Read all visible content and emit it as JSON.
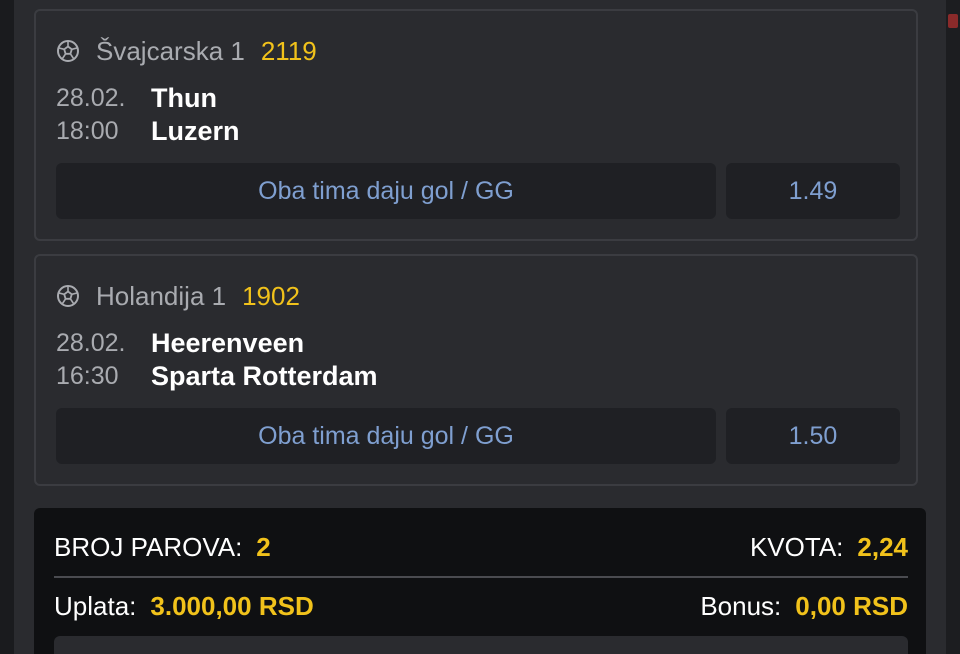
{
  "colors": {
    "accent": "#f1c21b",
    "pick_text": "#7f9fd0",
    "card_bg": "#2a2b2f",
    "summary_bg": "#0f1012"
  },
  "bets": [
    {
      "sport_icon": "soccer-ball-icon",
      "league": "Švajcarska 1",
      "code": "2119",
      "date": "28.02.",
      "time": "18:00",
      "home": "Thun",
      "away": "Luzern",
      "pick": "Oba tima daju gol / GG",
      "odd": "1.49"
    },
    {
      "sport_icon": "soccer-ball-icon",
      "league": "Holandija 1",
      "code": "1902",
      "date": "28.02.",
      "time": "16:30",
      "home": "Heerenveen",
      "away": "Sparta Rotterdam",
      "pick": "Oba tima daju gol / GG",
      "odd": "1.50"
    }
  ],
  "summary": {
    "pairs_label": "BROJ PAROVA:",
    "pairs_value": "2",
    "odds_label": "KVOTA:",
    "odds_value": "2,24",
    "stake_label": "Uplata:",
    "stake_value": "3.000,00 RSD",
    "bonus_label": "Bonus:",
    "bonus_value": "0,00 RSD"
  }
}
